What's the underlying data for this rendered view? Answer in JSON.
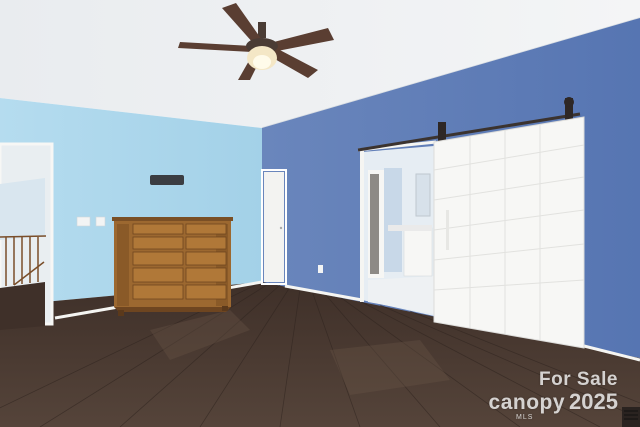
{
  "watermark": {
    "line1": "For Sale",
    "brand": "canopy",
    "year": "2025",
    "mls": "MLS"
  },
  "colors": {
    "ceiling": "#eef0f2",
    "left_wall": "#a9d6eb",
    "accent_wall": "#5f7cb5",
    "floor": "#4a3b33",
    "dresser": "#9c6830",
    "barn_door": "#f7f7f5",
    "trim": "#f5f5f2"
  }
}
